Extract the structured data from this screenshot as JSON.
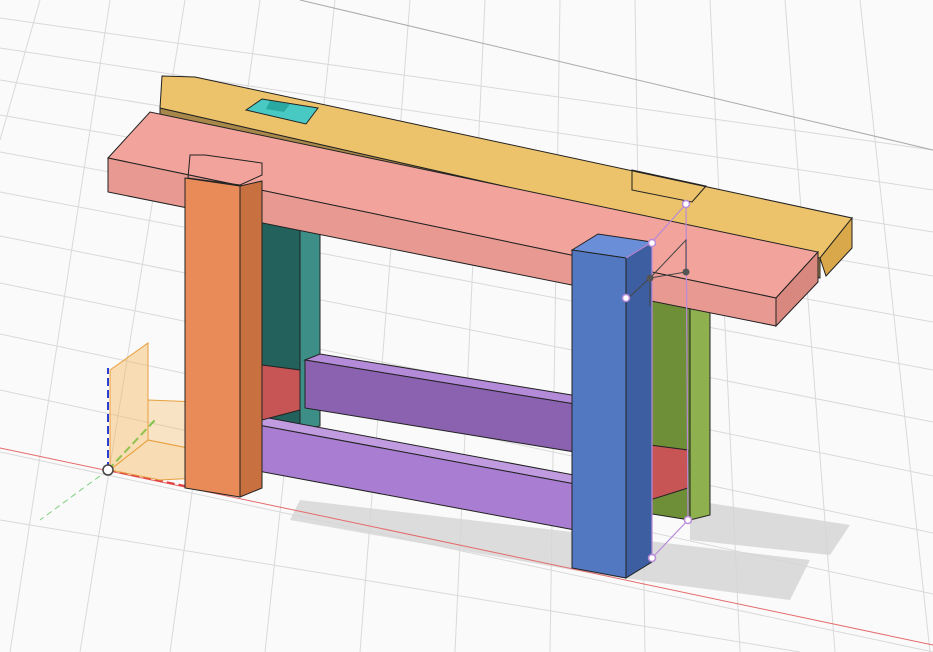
{
  "viewport": {
    "background": "#fafafa",
    "grid_color": "#d7d7d7",
    "x_axis_color": "#e46a6a",
    "y_axis_color": "#7fcf7f",
    "z_axis_color": "#2a3fd6"
  },
  "model": {
    "components": [
      {
        "name": "back-top-rail",
        "color": "#ecc26b"
      },
      {
        "name": "dog-hole-marker",
        "color": "#48c9c3"
      },
      {
        "name": "front-top-rail",
        "color": "#f2a39b"
      },
      {
        "name": "front-left-leg",
        "color": "#e98b58"
      },
      {
        "name": "back-left-leg",
        "color": "#2f7d77"
      },
      {
        "name": "front-right-leg",
        "color": "#5278c2"
      },
      {
        "name": "back-right-leg",
        "color": "#8fb04e"
      },
      {
        "name": "upper-stretcher",
        "color": "#9a6fc4"
      },
      {
        "name": "lower-stretcher",
        "color": "#a97ed2"
      },
      {
        "name": "end-block",
        "color": "#c85555"
      }
    ],
    "selection_color": "#b88ad8"
  }
}
